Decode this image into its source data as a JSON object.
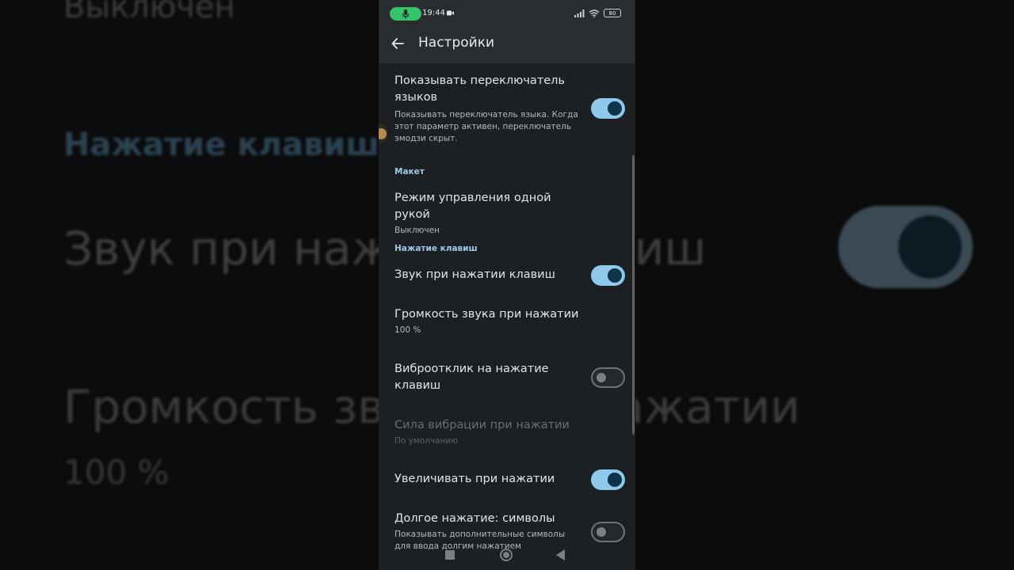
{
  "background": {
    "top_text": "Выключен",
    "section_text": "Нажатие клавиш",
    "sound_text": "Звук при нажатии клавиш",
    "volume_text": "Громкость звука при нажатии",
    "volume_value": "100 %"
  },
  "status_bar": {
    "time": "19:44",
    "battery": "80"
  },
  "app_bar": {
    "title": "Настройки"
  },
  "settings": {
    "show_language_switch": {
      "title": "Показывать переключатель языков",
      "summary": "Показывать переключатель языка. Когда этот параметр активен, переключатель эмодзи скрыт.",
      "enabled": true
    },
    "layout_header": "Макет",
    "one_hand_mode": {
      "title": "Режим управления одной рукой",
      "summary": "Выключен"
    },
    "keypress_header": "Нажатие клавиш",
    "key_sound": {
      "title": "Звук при нажатии клавиш",
      "enabled": true
    },
    "sound_volume": {
      "title": "Громкость звука при нажатии",
      "summary": "100 %"
    },
    "vibration": {
      "title": "Виброотклик на нажатие клавиш",
      "enabled": false
    },
    "vibration_strength": {
      "title": "Сила вибрации при нажатии",
      "summary": "По умолчанию",
      "disabled": true
    },
    "popup_on_press": {
      "title": "Увеличивать при нажатии",
      "enabled": true
    },
    "long_press_symbols": {
      "title": "Долгое нажатие: символы",
      "summary": "Показывать дополнительные символы для ввода долгим нажатием",
      "enabled": false
    }
  },
  "colors": {
    "accent": "#8ec8ea",
    "section_header": "#9ccbe9",
    "panel": "#1d2023",
    "mic_indicator": "#34c26b"
  }
}
